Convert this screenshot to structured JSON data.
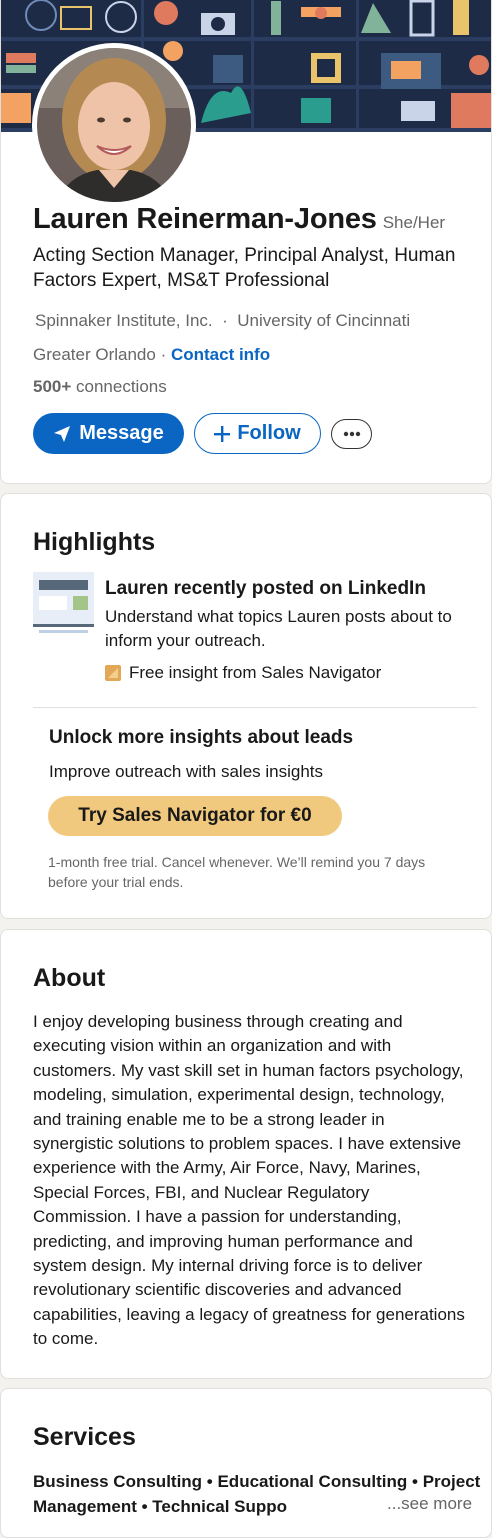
{
  "profile": {
    "name": "Lauren Reinerman-Jones",
    "pronouns": "She/Her",
    "headline": "Acting Section Manager, Principal Analyst, Human Factors Expert, MS&T Professional",
    "company": "Spinnaker Institute, Inc.",
    "separator": "·",
    "education": "University of Cincinnati",
    "location": "Greater Orlando",
    "location_separator": " · ",
    "contact_info": "Contact info",
    "connections_count": "500+",
    "connections_label": " connections",
    "buttons": {
      "message": "Message",
      "follow": "Follow",
      "more_icon": "ellipsis-icon"
    }
  },
  "highlights": {
    "title": "Highlights",
    "post_title": "Lauren recently posted on LinkedIn",
    "post_desc": "Understand what topics Lauren posts about to inform your outreach.",
    "insight_label": "Free insight from Sales Navigator",
    "unlock_title": "Unlock more insights about leads",
    "unlock_sub": "Improve outreach with sales insights",
    "cta": "Try Sales Navigator for €0",
    "trial_note": "1-month free trial. Cancel whenever. We’ll remind you 7 days before your trial ends."
  },
  "about": {
    "title": "About",
    "text": "I enjoy developing business through creating and executing vision within an organization and with customers. My vast skill set in human factors psychology, modeling, simulation, experimental design, technology, and training enable me to be a strong leader in synergistic solutions to problem spaces. I have extensive experience with the Army, Air Force, Navy, Marines, Special Forces, FBI, and Nuclear Regulatory Commission. I have a passion for understanding, predicting, and improving human performance and system design. My internal driving force is to deliver revolutionary scientific discoveries and advanced capabilities, leaving a legacy of greatness for generations to come."
  },
  "services": {
    "title": "Services",
    "list": "Business Consulting • Educational Consulting • Project Management • Technical Suppo",
    "see_more": "...see more"
  },
  "colors": {
    "brand_blue": "#0a66c2",
    "sales_gold": "#f0c97e",
    "muted_text": "#666666"
  }
}
